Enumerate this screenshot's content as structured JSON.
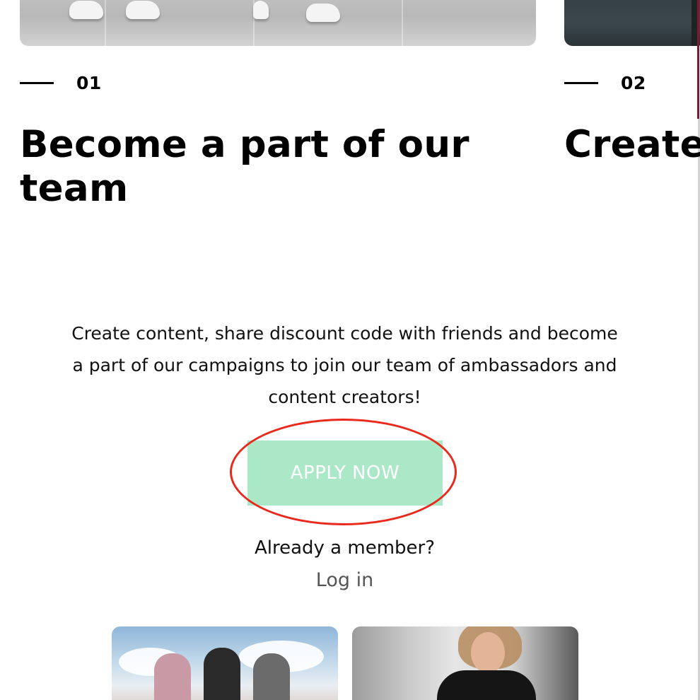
{
  "steps": [
    {
      "number": "01",
      "title_line1": "Become a part of our",
      "title_line2": "team"
    },
    {
      "number": "02",
      "title_line1": "Create"
    }
  ],
  "description": "Create content, share discount code with friends and become a part of our campaigns to join our team of ambassadors and content creators!",
  "cta": {
    "label": "APPLY NOW",
    "color": "#abe8c7",
    "highlight_color": "#e8291c"
  },
  "member": {
    "prompt": "Already a member?",
    "login_label": "Log in"
  },
  "colors": {
    "accent_line": "#7a1a2a"
  }
}
